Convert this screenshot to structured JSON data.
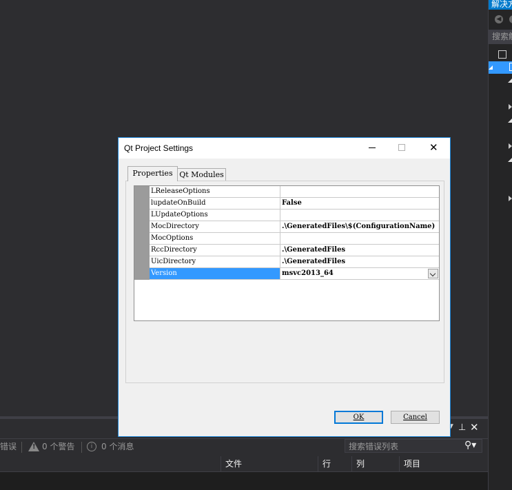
{
  "solution_explorer": {
    "title": "解决方",
    "search_placeholder": "搜索解"
  },
  "dialog": {
    "title": "Qt Project Settings",
    "tabs": [
      {
        "label": "Properties",
        "active": true
      },
      {
        "label": "Qt Modules",
        "active": false
      }
    ],
    "properties": [
      {
        "name": "LReleaseOptions",
        "value": ""
      },
      {
        "name": "lupdateOnBuild",
        "value": "False"
      },
      {
        "name": "LUpdateOptions",
        "value": ""
      },
      {
        "name": "MocDirectory",
        "value": ".\\GeneratedFiles\\$(ConfigurationName)"
      },
      {
        "name": "MocOptions",
        "value": ""
      },
      {
        "name": "RccDirectory",
        "value": ".\\GeneratedFiles"
      },
      {
        "name": "UicDirectory",
        "value": ".\\GeneratedFiles"
      },
      {
        "name": "Version",
        "value": "msvc2013_64",
        "selected": true
      }
    ],
    "ok_label": "OK",
    "cancel_label": "Cancel"
  },
  "error_list": {
    "errors_label": "错误",
    "warnings_label": "0 个警告",
    "messages_label": "0 个消息",
    "search_placeholder": "搜索错误列表",
    "columns": [
      "文件",
      "行",
      "列",
      "项目"
    ]
  },
  "colors": {
    "ide_background": "#2d2d30",
    "accent": "#007acc",
    "selection": "#3399ff",
    "dialog_border": "#1883d7"
  }
}
